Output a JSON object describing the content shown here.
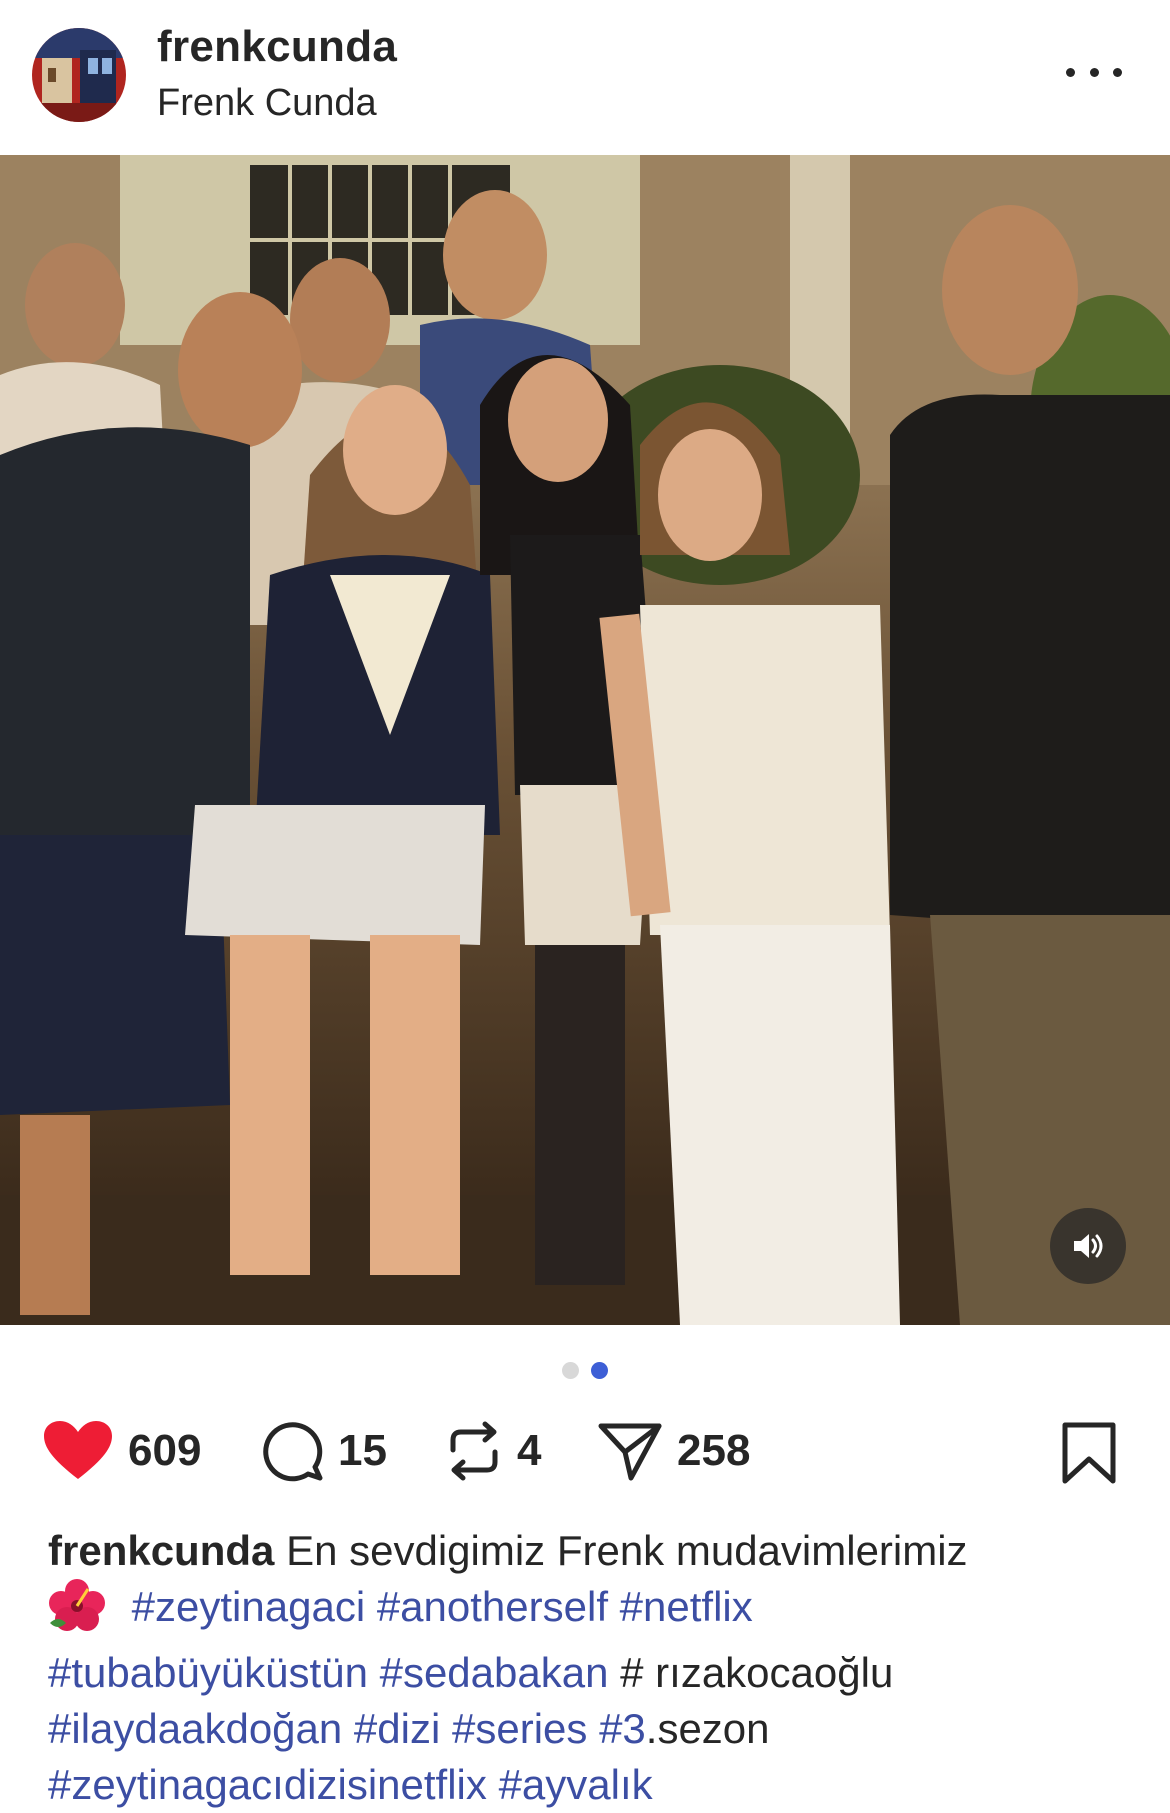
{
  "post": {
    "username": "frenkcunda",
    "full_name": "Frenk Cunda",
    "likes": "609",
    "comments": "15",
    "reposts": "4",
    "shares": "258",
    "carousel": {
      "count": 2,
      "active_index": 1
    }
  },
  "caption": {
    "username": "frenkcunda",
    "text_1": "En sevdigimiz Frenk mudavimlerimiz",
    "emoji": "🌺",
    "tags_line2": [
      "#zeytinagaci",
      "#anotherself",
      "#netflix"
    ],
    "line3_tags": [
      "#tubabüyüküstün",
      "#sedabakan"
    ],
    "line3_text": "# rızakocaoğlu",
    "line4_tags": [
      "#ilaydaakdoğan",
      "#dizi",
      "#series",
      "#3"
    ],
    "line4_text": ".sezon",
    "line5_tags": [
      "#zeytinagacıdizisinetflix",
      "#ayvalık"
    ]
  },
  "colors": {
    "like": "#ee1d35",
    "hashtag": "#3c4ea3",
    "active_dot": "#3d5fd6"
  },
  "icons": {
    "like": "heart-icon",
    "comment": "comment-icon",
    "repost": "repost-icon",
    "share": "share-icon",
    "save": "bookmark-icon",
    "sound": "speaker-icon",
    "more": "more-icon"
  }
}
